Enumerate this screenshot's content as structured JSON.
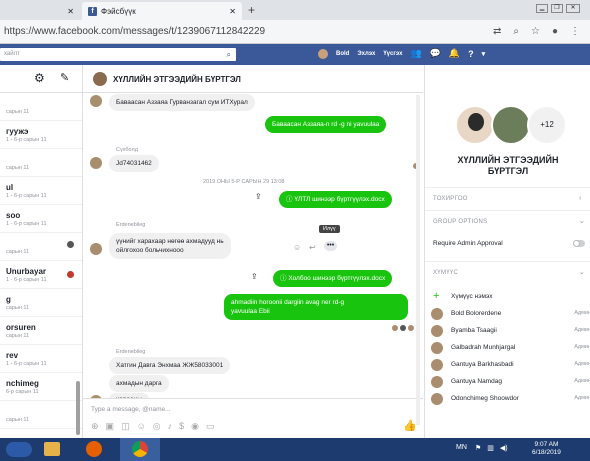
{
  "browser": {
    "tab_title": "Фэйсбүүк",
    "url": "https://www.facebook.com/messages/t/1239067112842229"
  },
  "fb": {
    "search_placeholder": "хайлт",
    "user": "Bold",
    "nav1": "Эхлэх",
    "nav2": "Үүсгэх"
  },
  "chat": {
    "title": "ХҮЛЛИЙН ЭТГЭЭДИЙН БҮРТГЭЛ"
  },
  "left_items": [
    {
      "name": "",
      "time": "сарын 11"
    },
    {
      "name": "гуужэ",
      "time": "1 - 6-р сарын 11"
    },
    {
      "name": "",
      "time": "сарын 11"
    },
    {
      "name": "ul",
      "time": "1 - 6-р сарын 11"
    },
    {
      "name": "soo",
      "time": "1 - 6-р сарын 11"
    },
    {
      "name": "",
      "time": "сарын 11"
    },
    {
      "name": "Unurbayar",
      "time": "1 - 6-р сарын 11"
    },
    {
      "name": "g",
      "time": "сарын 11"
    },
    {
      "name": "orsuren",
      "time": "сарын 11"
    },
    {
      "name": "rev",
      "time": "1 - 6-р сарын 11"
    },
    {
      "name": "nchimeg",
      "time": "6-р сарын 11"
    },
    {
      "name": "",
      "time": "сарын 11"
    }
  ],
  "messages": {
    "m1": "Баваасан Аззаяа Гурванзагал сум ИТХурал",
    "m2": "Баваасан Аззаяа-n rd -g ni yavuulaa",
    "sender1": "Сүхболд",
    "m3": "Jd74031462",
    "date": "2019 ОНЫ 5-Р САРЫН 29 13:08",
    "file1": "ҮЛТЛ шинээр бүртгүүлэх.docx",
    "sender2": "Erdenebileg",
    "m4a": "үүнийг харахаар нөгөө ахмадууд нь",
    "m4b": "ойлгохоо больчихнооо",
    "tooltip": "Илүү",
    "file2": "Холбоо шинээр бүртгүүлэх.docx",
    "m5a": "ahmadiin horoonii dargiin avag ner rd-g",
    "m5b": "yavuulaa Ebii",
    "sender3": "Erdenebileg",
    "m6": "Хатгин Давга Энхмаа ЖЖ58033001",
    "m7": "ахмадын дарга",
    "m8": "хорооны",
    "input_placeholder": "Type a message, @name..."
  },
  "right": {
    "title_line1": "ХҮЛЛИЙН ЭТГЭЭДИЙН",
    "title_line2": "БҮРТГЭЛ",
    "plus_count": "+12",
    "sec1": "ТОХИРГОО",
    "sec2": "GROUP OPTIONS",
    "require_admin": "Require Admin Approval",
    "sec3": "ХҮМҮҮС",
    "add_people": "Хүмүүс нэмэх",
    "members": [
      {
        "name": "Bold Bolorerdene",
        "role": "Админ"
      },
      {
        "name": "Byamba Tsaagii",
        "role": "Админ"
      },
      {
        "name": "Galbadrah Munhjargal",
        "role": "Админ"
      },
      {
        "name": "Gantuya Barkhasbadi",
        "role": "Админ"
      },
      {
        "name": "Gantuya Namdag",
        "role": "Админ"
      },
      {
        "name": "Odonchimeg Shoowdor",
        "role": "Админ"
      }
    ]
  },
  "taskbar": {
    "lang": "MN",
    "time": "9:07 AM",
    "date": "6/18/2019"
  }
}
